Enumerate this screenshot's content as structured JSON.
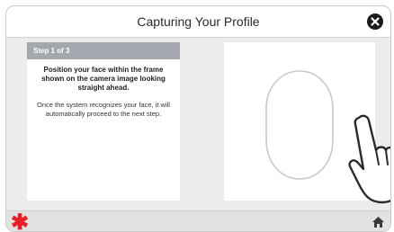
{
  "header": {
    "title": "Capturing Your Profile",
    "close_icon": "close-icon"
  },
  "instructions": {
    "step_label": "Step 1 of 3",
    "primary": "Position your face within the frame shown on the camera image looking straight ahead.",
    "secondary": "Once the system recognizes your face, it will automatically proceed to the next step."
  },
  "camera": {
    "face_frame_icon": "face-oval-outline"
  },
  "footer": {
    "logo_icon": "asterisk-logo",
    "home_icon": "home-icon"
  },
  "colors": {
    "accent_red": "#e8202a",
    "step_bar": "#a4a7ae",
    "background": "#ececec"
  }
}
